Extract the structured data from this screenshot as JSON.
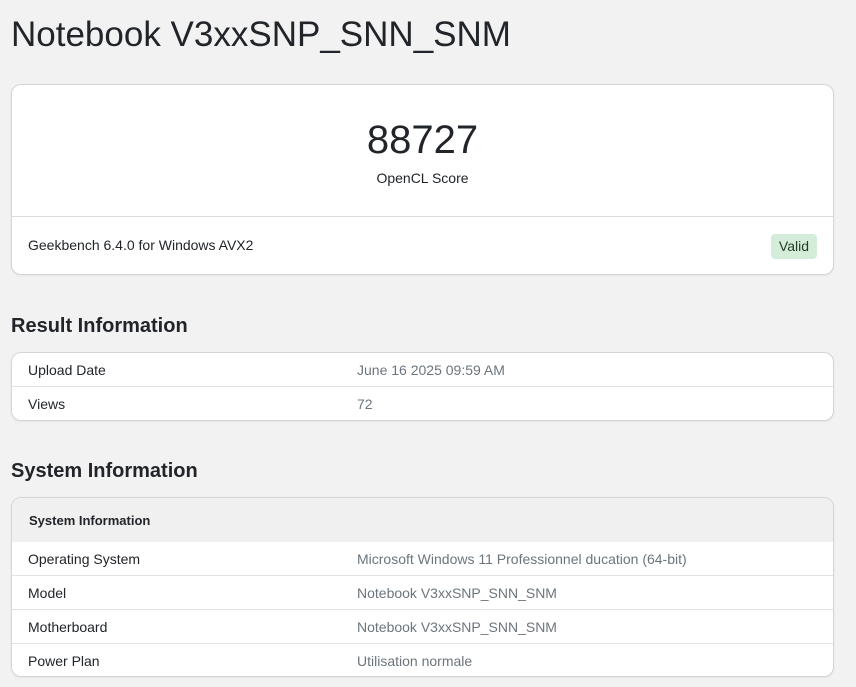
{
  "page_title": "Notebook V3xxSNP_SNN_SNM",
  "score": {
    "value": "88727",
    "label": "OpenCL Score",
    "version": "Geekbench 6.4.0 for Windows AVX2",
    "status": "Valid",
    "status_color": "#d4edda"
  },
  "result_info": {
    "heading": "Result Information",
    "rows": [
      {
        "label": "Upload Date",
        "value": "June 16 2025 09:59 AM"
      },
      {
        "label": "Views",
        "value": "72"
      }
    ]
  },
  "system_info": {
    "heading": "System Information",
    "table_header": "System Information",
    "rows": [
      {
        "label": "Operating System",
        "value": "Microsoft Windows 11 Professionnel ducation (64-bit)"
      },
      {
        "label": "Model",
        "value": "Notebook V3xxSNP_SNN_SNM"
      },
      {
        "label": "Motherboard",
        "value": "Notebook V3xxSNP_SNN_SNM"
      },
      {
        "label": "Power Plan",
        "value": "Utilisation normale"
      }
    ]
  }
}
